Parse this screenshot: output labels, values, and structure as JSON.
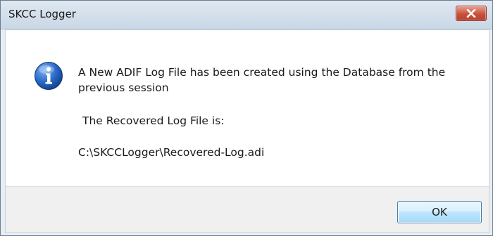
{
  "window": {
    "title": "SKCC Logger",
    "close_symbol": "x"
  },
  "message": {
    "icon": "info-icon",
    "line1": "A New ADIF Log File has been created using the Database from the previous session",
    "line2": "The Recovered Log File is:",
    "line3": "C:\\SKCCLogger\\Recovered-Log.adi"
  },
  "buttons": {
    "ok_label": "OK"
  },
  "colors": {
    "info_blue": "#1f5fb8",
    "close_red": "#c9523c"
  }
}
